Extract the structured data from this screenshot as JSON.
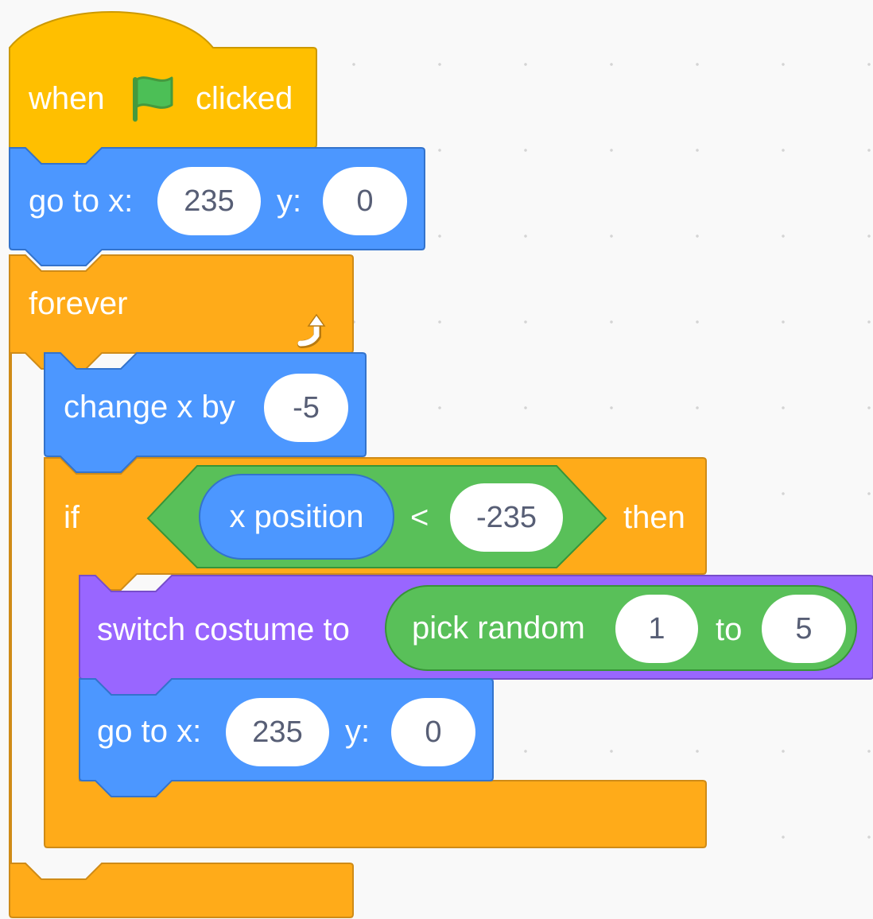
{
  "colors": {
    "events": "#FFBF00",
    "events_border": "#CC9900",
    "motion": "#4C97FF",
    "motion_border": "#3373CC",
    "control": "#FFAB19",
    "control_border": "#CF8B17",
    "looks": "#9966FF",
    "looks_border": "#774DCB",
    "operators": "#59C059",
    "operators_border": "#389438",
    "input_text": "#575E75",
    "flag_green": "#4CBF56",
    "flag_border": "#45993D"
  },
  "hat": {
    "when": "when",
    "flag_icon": "green-flag-icon",
    "clicked": "clicked"
  },
  "goto1": {
    "label": "go to x:",
    "x": "235",
    "y_label": "y:",
    "y": "0"
  },
  "forever": {
    "label": "forever",
    "loop_icon": "loop-arrow-icon"
  },
  "change_x": {
    "label": "change x by",
    "value": "-5"
  },
  "if_block": {
    "if_label": "if",
    "reporter": "x position",
    "operator": "<",
    "compare_value": "-235",
    "then_label": "then"
  },
  "switch_costume": {
    "label": "switch costume to",
    "random_label": "pick random",
    "from": "1",
    "to_label": "to",
    "to": "5"
  },
  "goto2": {
    "label": "go to x:",
    "x": "235",
    "y_label": "y:",
    "y": "0"
  }
}
